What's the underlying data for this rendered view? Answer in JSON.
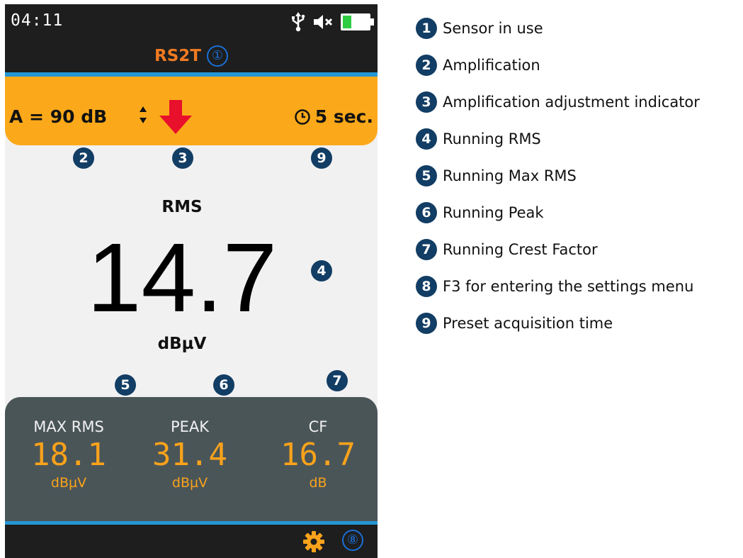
{
  "status": {
    "time": "04:11"
  },
  "sensor": {
    "name": "RS2T",
    "callout": "①"
  },
  "amp": {
    "text": "A = 90 dB",
    "timer": "5 sec."
  },
  "badges": {
    "b2": "2",
    "b3": "3",
    "b9": "9",
    "b4": "4",
    "b5": "5",
    "b6": "6",
    "b7": "7"
  },
  "rms": {
    "label": "RMS",
    "value": "14.7",
    "unit": "dBµV"
  },
  "stats": [
    {
      "label": "MAX RMS",
      "value": "18.1",
      "unit": "dBµV"
    },
    {
      "label": "PEAK",
      "value": "31.4",
      "unit": "dBµV"
    },
    {
      "label": "CF",
      "value": "16.7",
      "unit": "dB"
    }
  ],
  "footer": {
    "callout": "⑧"
  },
  "legend": [
    {
      "num": "1",
      "text": "Sensor in use"
    },
    {
      "num": "2",
      "text": "Amplification"
    },
    {
      "num": "3",
      "text": "Amplification adjustment indicator"
    },
    {
      "num": "4",
      "text": "Running RMS"
    },
    {
      "num": "5",
      "text": "Running Max RMS"
    },
    {
      "num": "6",
      "text": "Running Peak"
    },
    {
      "num": "7",
      "text": "Running Crest Factor"
    },
    {
      "num": "8",
      "text": "F3 for entering the settings menu"
    },
    {
      "num": "9",
      "text": "Preset acquisition time"
    }
  ],
  "colors": {
    "accent_orange": "#fba91a",
    "value_orange": "#f9a21b",
    "sensor_orange": "#f07a22",
    "badge_navy": "#123d64",
    "callout_blue": "#1a6fd6",
    "divider_blue": "#2596d6",
    "panel_gray": "#4a5558"
  },
  "icons": [
    "usb-icon",
    "mute-icon",
    "battery-icon",
    "updown-icon",
    "down-arrow-icon",
    "clock-icon",
    "gear-icon"
  ]
}
